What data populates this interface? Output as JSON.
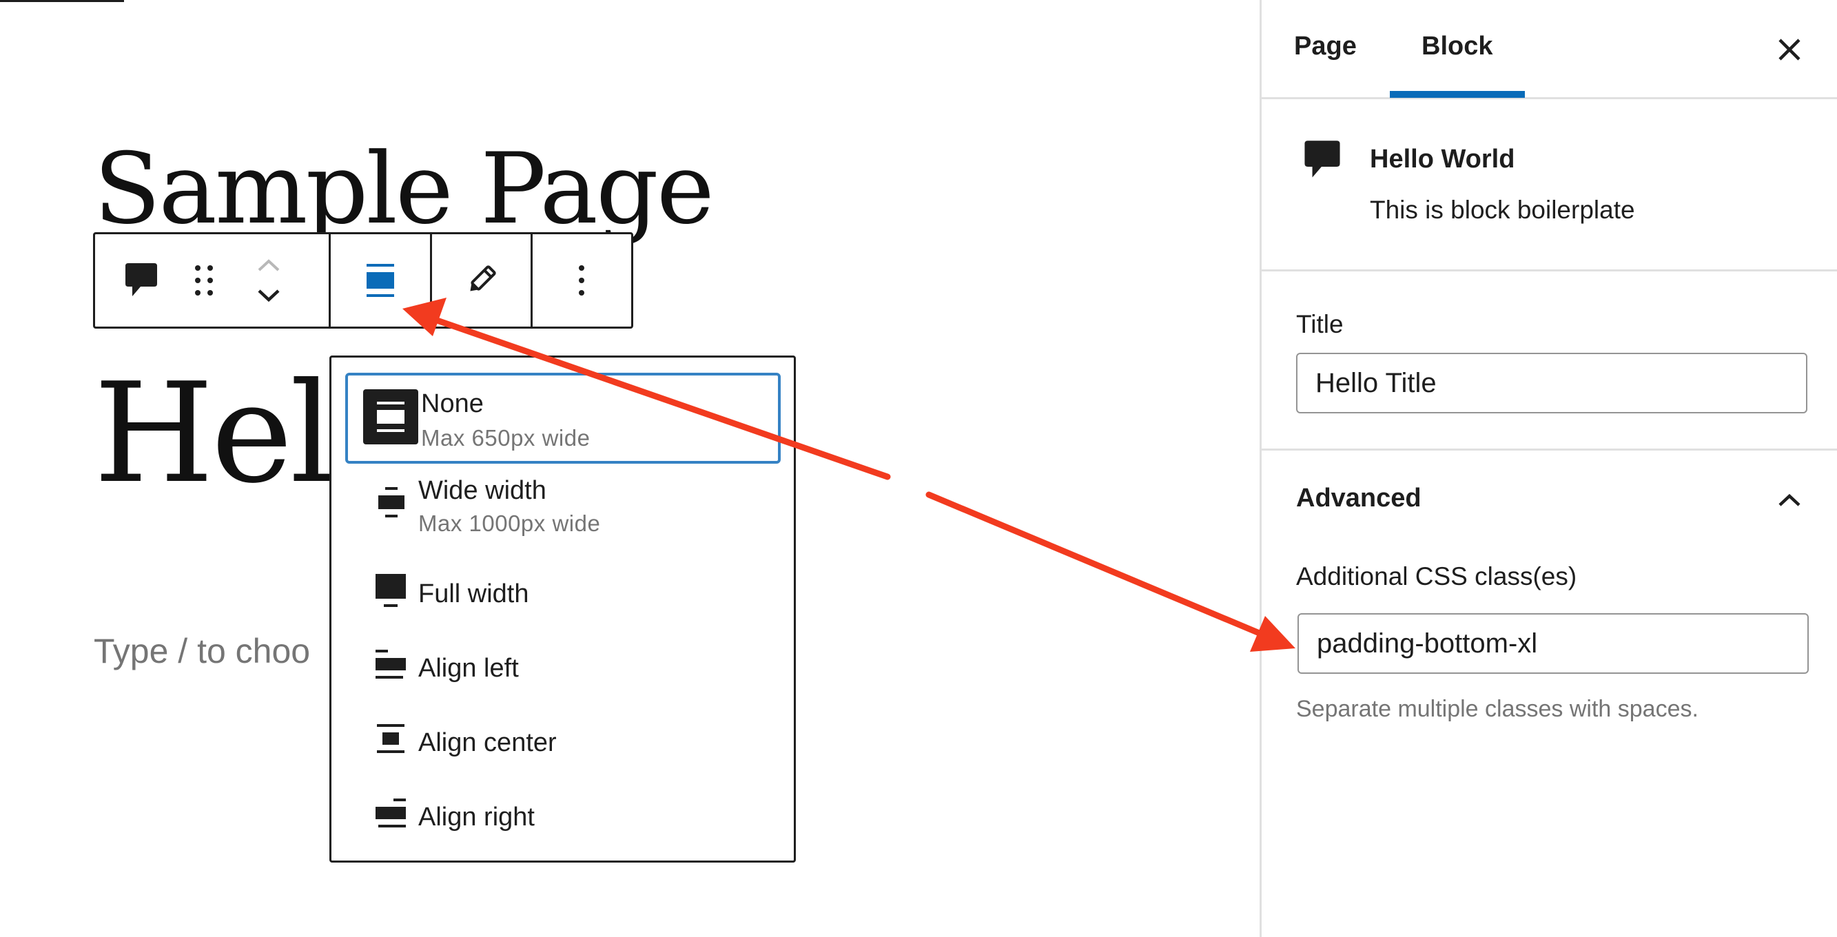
{
  "editor": {
    "page_title": "Sample Page",
    "heading": "Hell",
    "placeholder": "Type / to choo"
  },
  "toolbar": {
    "icons": [
      "comment-icon",
      "drag-handle-icon",
      "chevron-up-icon",
      "chevron-down-icon",
      "align-none-icon",
      "pencil-icon",
      "more-vertical-icon"
    ]
  },
  "alignment_menu": {
    "items": [
      {
        "label": "None",
        "description": "Max 650px wide",
        "icon": "align-none-icon",
        "selected": true
      },
      {
        "label": "Wide width",
        "description": "Max 1000px wide",
        "icon": "align-wide-icon"
      },
      {
        "label": "Full width",
        "icon": "align-full-icon"
      },
      {
        "label": "Align left",
        "icon": "align-left-icon"
      },
      {
        "label": "Align center",
        "icon": "align-center-icon"
      },
      {
        "label": "Align right",
        "icon": "align-right-icon"
      }
    ]
  },
  "sidebar": {
    "tabs": [
      {
        "label": "Page",
        "active": false
      },
      {
        "label": "Block",
        "active": true
      }
    ],
    "block_card": {
      "title": "Hello World",
      "description": "This is block boilerplate"
    },
    "title_field": {
      "label": "Title",
      "value": "Hello Title"
    },
    "advanced": {
      "title": "Advanced",
      "css_label": "Additional CSS class(es)",
      "css_value": "padding-bottom-xl",
      "help": "Separate multiple classes with spaces."
    }
  },
  "colors": {
    "accent": "#0a6bb8",
    "selected_border": "#3582c4",
    "annotation_arrow": "#f23b1f",
    "text": "#1e1e1e",
    "muted": "#757575"
  }
}
